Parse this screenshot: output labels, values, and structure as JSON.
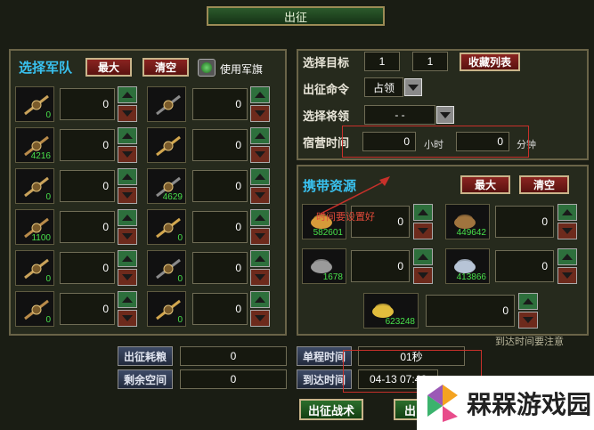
{
  "title": "出征",
  "left": {
    "select_army": "选择军队",
    "max": "最大",
    "clear": "清空",
    "use_flag": "使用军旗",
    "units": [
      {
        "icon": "dagger-icon",
        "count": "0",
        "value": "0"
      },
      {
        "icon": "trident-icon",
        "count": "",
        "value": "0"
      },
      {
        "icon": "spear-icon",
        "count": "4216",
        "value": "0"
      },
      {
        "icon": "lance-icon",
        "count": "",
        "value": "0"
      },
      {
        "icon": "shield-icon",
        "count": "0",
        "value": "0"
      },
      {
        "icon": "bow-icon",
        "count": "4629",
        "value": "0"
      },
      {
        "icon": "horse-icon",
        "count": "1100",
        "value": "0"
      },
      {
        "icon": "armored-horse-icon",
        "count": "0",
        "value": "0"
      },
      {
        "icon": "siege-engine-icon",
        "count": "0",
        "value": "0"
      },
      {
        "icon": "ballista-icon",
        "count": "0",
        "value": "0"
      },
      {
        "icon": "catapult-icon",
        "count": "0",
        "value": "0"
      },
      {
        "icon": "trebuchet-icon",
        "count": "0",
        "value": "0"
      }
    ]
  },
  "target": {
    "select_target": "选择目标",
    "x": "1",
    "y": "1",
    "favorites": "收藏列表",
    "command_label": "出征命令",
    "command_value": "占领",
    "general_label": "选择将领",
    "general_value": "- -",
    "camp_label": "宿营时间",
    "hours": "0",
    "hours_unit": "小时",
    "minutes": "0",
    "minutes_unit": "分钟"
  },
  "resources": {
    "title": "携带资源",
    "max": "最大",
    "clear": "清空",
    "annotation": "时间要设置好",
    "items": [
      {
        "icon": "grain-icon",
        "count": "582601",
        "value": "0"
      },
      {
        "icon": "wood-icon",
        "count": "449642",
        "value": "0"
      },
      {
        "icon": "stone-icon",
        "count": "1678",
        "value": "0"
      },
      {
        "icon": "iron-icon",
        "count": "413866",
        "value": "0"
      },
      {
        "icon": "gold-icon",
        "count": "623248",
        "value": "0"
      }
    ]
  },
  "bottom": {
    "food_cost_label": "出征耗粮",
    "food_cost_value": "0",
    "space_label": "剩余空间",
    "space_value": "0",
    "oneway_label": "单程时间",
    "oneway_value": "01秒",
    "arrival_label": "到达时间",
    "arrival_value": "04-13 07:46",
    "arrival_note": "到达时间要注意",
    "tactics_button": "出征战术",
    "go_button": "出"
  },
  "watermark": "槑槑游戏园"
}
